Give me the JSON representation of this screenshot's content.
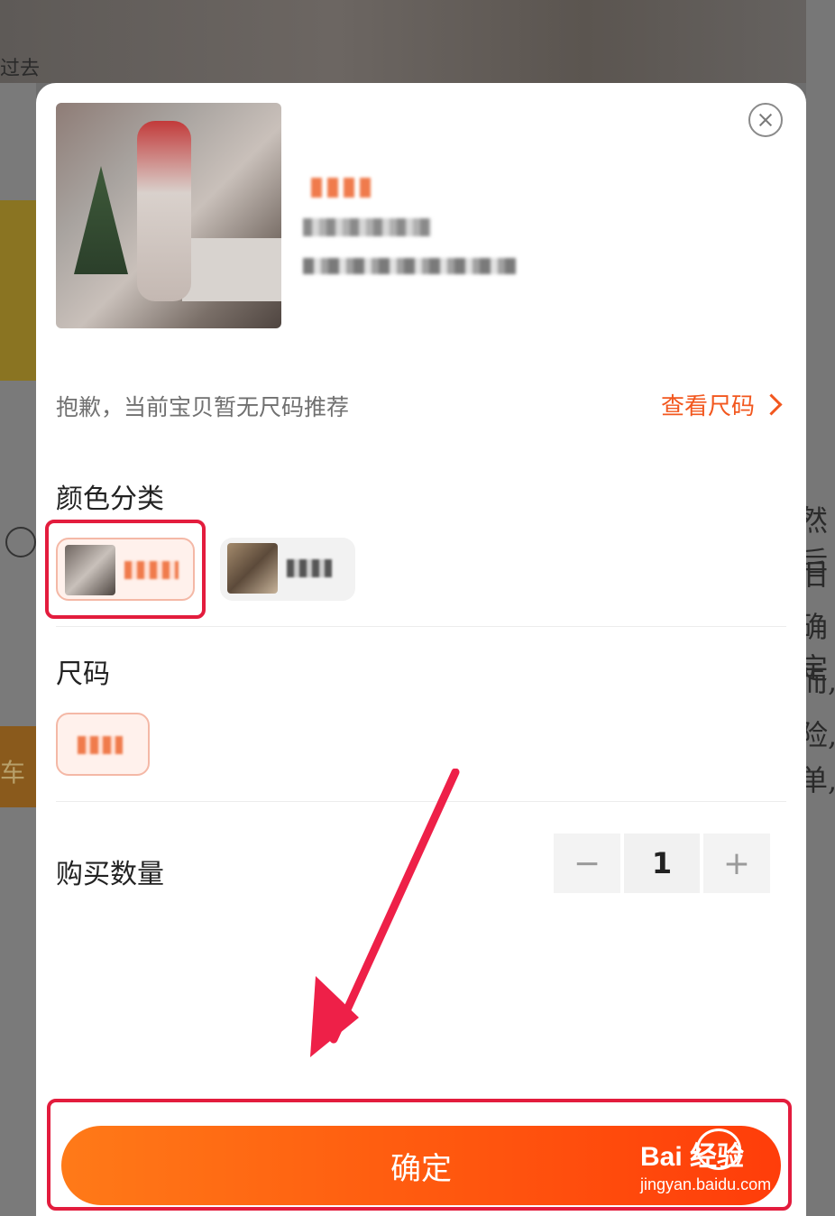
{
  "background": {
    "left_text": "过去",
    "left_bottom_text": "车",
    "right_texts": [
      "然后",
      "后",
      "确定",
      "而,",
      "险,",
      "单,"
    ]
  },
  "product": {
    "image_alt": "product-photo",
    "close_icon": "close-icon"
  },
  "size_recommendation": {
    "note": "抱歉，当前宝贝暂无尺码推荐",
    "link_label": "查看尺码"
  },
  "color_section": {
    "title": "颜色分类",
    "options": [
      {
        "selected": true
      },
      {
        "selected": false
      }
    ]
  },
  "size_section": {
    "title": "尺码",
    "options": [
      {
        "selected": true
      }
    ]
  },
  "quantity": {
    "label": "购买数量",
    "minus": "−",
    "value": "1",
    "plus": "+"
  },
  "confirm_button": {
    "label": "确定"
  },
  "watermark": {
    "brand": "Bai 经验",
    "url": "jingyan.baidu.com"
  },
  "colors": {
    "accent": "#f2571e",
    "button_start": "#ff7a18",
    "button_end": "#ff3d0a",
    "highlight_box": "#e31c3d"
  }
}
